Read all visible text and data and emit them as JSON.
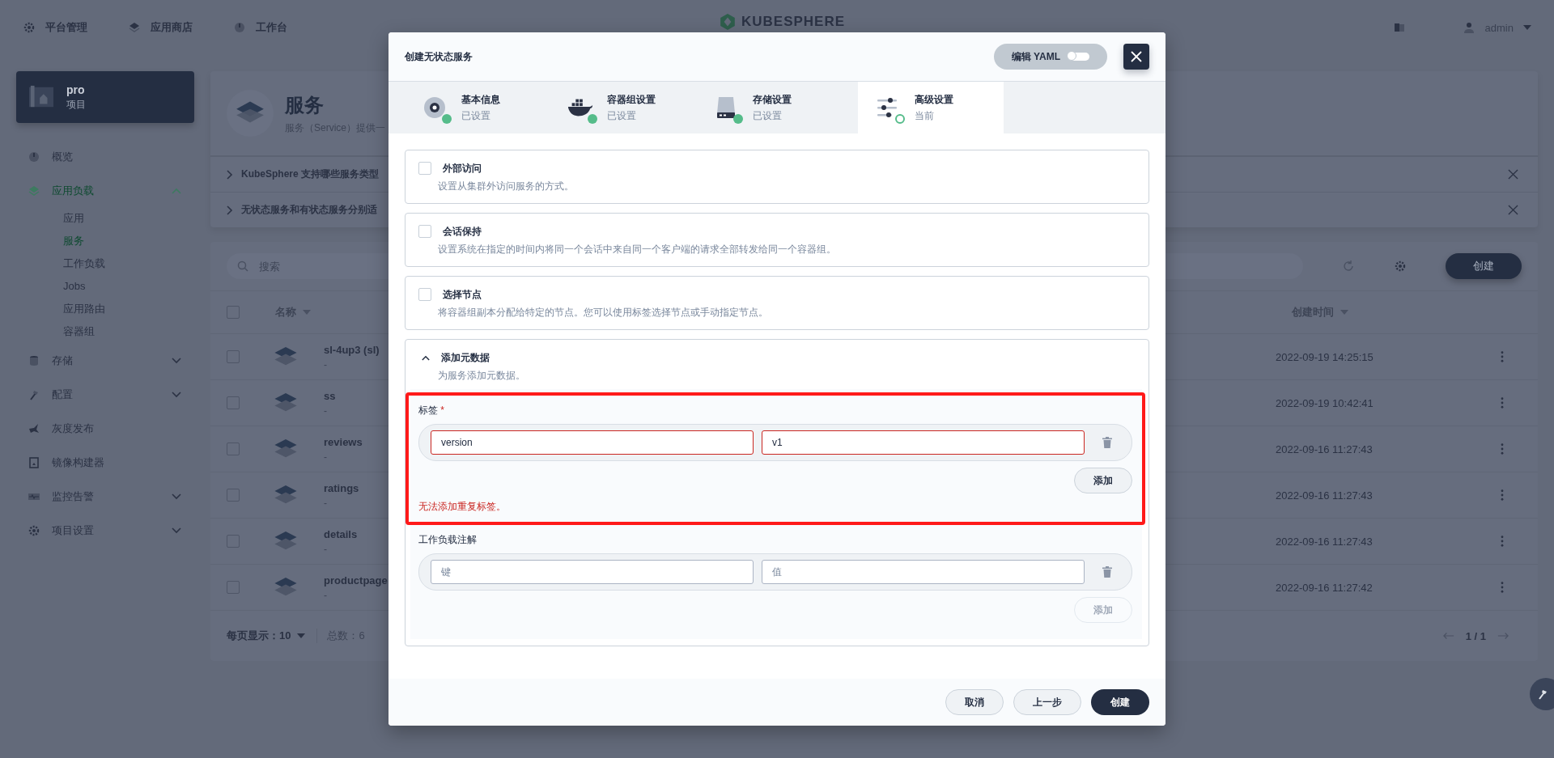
{
  "top_nav": [
    {
      "label": "平台管理"
    },
    {
      "label": "应用商店"
    },
    {
      "label": "工作台"
    }
  ],
  "logo": "KUBESPHERE",
  "user": "admin",
  "project": {
    "name": "pro",
    "type": "项目"
  },
  "sidebar": [
    {
      "label": "概览",
      "kind": "link",
      "selected": false
    },
    {
      "label": "应用负载",
      "kind": "group",
      "selected": true,
      "expanded": true,
      "children": [
        {
          "label": "应用",
          "selected": false
        },
        {
          "label": "服务",
          "selected": true
        },
        {
          "label": "工作负载",
          "selected": false
        },
        {
          "label": "Jobs",
          "selected": false
        },
        {
          "label": "应用路由",
          "selected": false
        },
        {
          "label": "容器组",
          "selected": false
        }
      ]
    },
    {
      "label": "存储",
      "kind": "group",
      "selected": false,
      "expanded": false
    },
    {
      "label": "配置",
      "kind": "group",
      "selected": false,
      "expanded": false
    },
    {
      "label": "灰度发布",
      "kind": "link",
      "selected": false
    },
    {
      "label": "镜像构建器",
      "kind": "link",
      "selected": false
    },
    {
      "label": "监控告警",
      "kind": "group",
      "selected": false,
      "expanded": false
    },
    {
      "label": "项目设置",
      "kind": "group",
      "selected": false,
      "expanded": false
    }
  ],
  "page": {
    "title": "服务",
    "description": "服务（Service）提供一"
  },
  "faq": [
    "KubeSphere 支持哪些服务类型",
    "无状态服务和有状态服务分别适"
  ],
  "search": {
    "placeholder": "搜索"
  },
  "create_button": "创建",
  "table": {
    "select_all": false,
    "columns": [
      "名称",
      "创建时间"
    ],
    "rows": [
      {
        "name": "sl-4up3 (sl)",
        "description": "-",
        "created": "2022-09-19 14:25:15",
        "selected": false
      },
      {
        "name": "ss",
        "description": "-",
        "created": "2022-09-19 10:42:41",
        "selected": false
      },
      {
        "name": "reviews",
        "description": "-",
        "created": "2022-09-16 11:27:43",
        "selected": false
      },
      {
        "name": "ratings",
        "description": "-",
        "created": "2022-09-16 11:27:43",
        "selected": false
      },
      {
        "name": "details",
        "description": "-",
        "created": "2022-09-16 11:27:43",
        "selected": false
      },
      {
        "name": "productpage",
        "description": "-",
        "created": "2022-09-16 11:27:42",
        "selected": false
      }
    ]
  },
  "pagination": {
    "page_size_label": "每页显示：",
    "page_size": "10",
    "total": "总数：6",
    "page": "1 / 1"
  },
  "modal": {
    "title": "创建无状态服务",
    "yaml_toggle": {
      "label": "编辑 YAML",
      "on": false
    },
    "steps": [
      {
        "title": "基本信息",
        "status": "已设置",
        "done": true,
        "selected": false
      },
      {
        "title": "容器组设置",
        "status": "已设置",
        "done": true,
        "selected": false
      },
      {
        "title": "存储设置",
        "status": "已设置",
        "done": true,
        "selected": false
      },
      {
        "title": "高级设置",
        "status": "当前",
        "done": false,
        "selected": true
      }
    ],
    "sections": [
      {
        "kind": "checkbox",
        "checked": false,
        "title": "外部访问",
        "description": "设置从集群外访问服务的方式。"
      },
      {
        "kind": "checkbox",
        "checked": false,
        "title": "会话保持",
        "description": "设置系统在指定的时间内将同一个会话中来自同一个客户端的请求全部转发给同一个容器组。"
      },
      {
        "kind": "checkbox",
        "checked": false,
        "title": "选择节点",
        "description": "将容器组副本分配给特定的节点。您可以使用标签选择节点或手动指定节点。"
      },
      {
        "kind": "expandable",
        "expanded": true,
        "title": "添加元数据",
        "description": "为服务添加元数据。",
        "groups": [
          {
            "label": "标签",
            "required_mark": "*",
            "rows": [
              {
                "key": "version",
                "value": "v1",
                "error": true
              }
            ],
            "add": "添加",
            "add_disabled": false,
            "error_message": "无法添加重复标签。"
          },
          {
            "label": "工作负载注解",
            "rows": [
              {
                "key_placeholder": "键",
                "value_placeholder": "值",
                "error": false
              }
            ],
            "add": "添加",
            "add_disabled": true
          }
        ]
      }
    ],
    "buttons": [
      {
        "label": "取消",
        "kind": "secondary"
      },
      {
        "label": "上一步",
        "kind": "secondary"
      },
      {
        "label": "创建",
        "kind": "primary"
      }
    ]
  }
}
